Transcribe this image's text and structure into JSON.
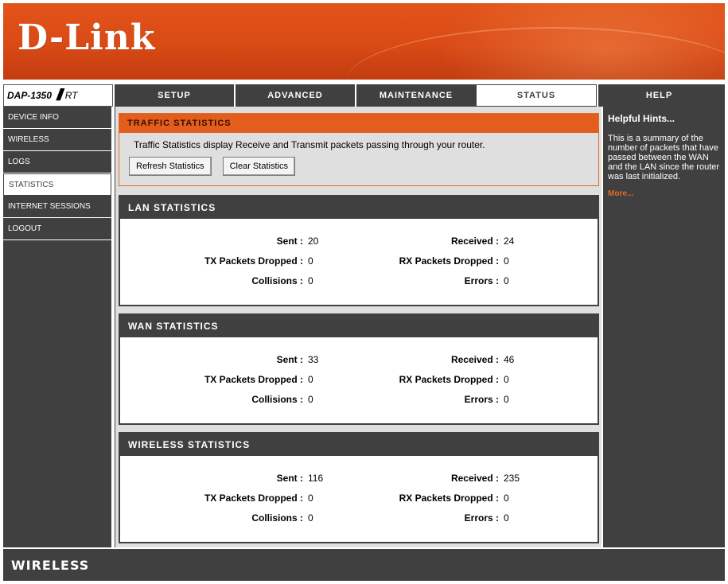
{
  "brand": {
    "logo": "D-Link"
  },
  "model": {
    "name": "DAP-1350",
    "slashes": "///",
    "mode": "RT"
  },
  "tabs": [
    {
      "label": "SETUP"
    },
    {
      "label": "ADVANCED"
    },
    {
      "label": "MAINTENANCE"
    },
    {
      "label": "STATUS",
      "active": true
    },
    {
      "label": "HELP"
    }
  ],
  "sidebar": {
    "items": [
      {
        "label": "DEVICE INFO"
      },
      {
        "label": "WIRELESS"
      },
      {
        "label": "LOGS"
      },
      {
        "label": "STATISTICS",
        "active": true
      },
      {
        "label": "INTERNET SESSIONS"
      },
      {
        "label": "LOGOUT"
      }
    ]
  },
  "traffic": {
    "title": "TRAFFIC STATISTICS",
    "description": "Traffic Statistics display Receive and Transmit packets passing through your router.",
    "refresh_label": "Refresh Statistics",
    "clear_label": "Clear Statistics"
  },
  "labels": {
    "sent": "Sent :",
    "received": "Received :",
    "tx_dropped": "TX Packets Dropped :",
    "rx_dropped": "RX Packets Dropped :",
    "collisions": "Collisions :",
    "errors": "Errors :"
  },
  "lan": {
    "title": "LAN STATISTICS",
    "sent": "20",
    "received": "24",
    "tx_dropped": "0",
    "rx_dropped": "0",
    "collisions": "0",
    "errors": "0"
  },
  "wan": {
    "title": "WAN STATISTICS",
    "sent": "33",
    "received": "46",
    "tx_dropped": "0",
    "rx_dropped": "0",
    "collisions": "0",
    "errors": "0"
  },
  "wireless": {
    "title": "WIRELESS STATISTICS",
    "sent": "116",
    "received": "235",
    "tx_dropped": "0",
    "rx_dropped": "0",
    "collisions": "0",
    "errors": "0"
  },
  "help": {
    "title": "Helpful Hints...",
    "text": "This is a summary of the number of packets that have passed between the WAN and the LAN since the router was last initialized.",
    "more": "More..."
  },
  "footer": {
    "text": "WIRELESS"
  },
  "colors": {
    "accent": "#e35e1d",
    "dark": "#404040",
    "panel": "#dfdfdf"
  }
}
